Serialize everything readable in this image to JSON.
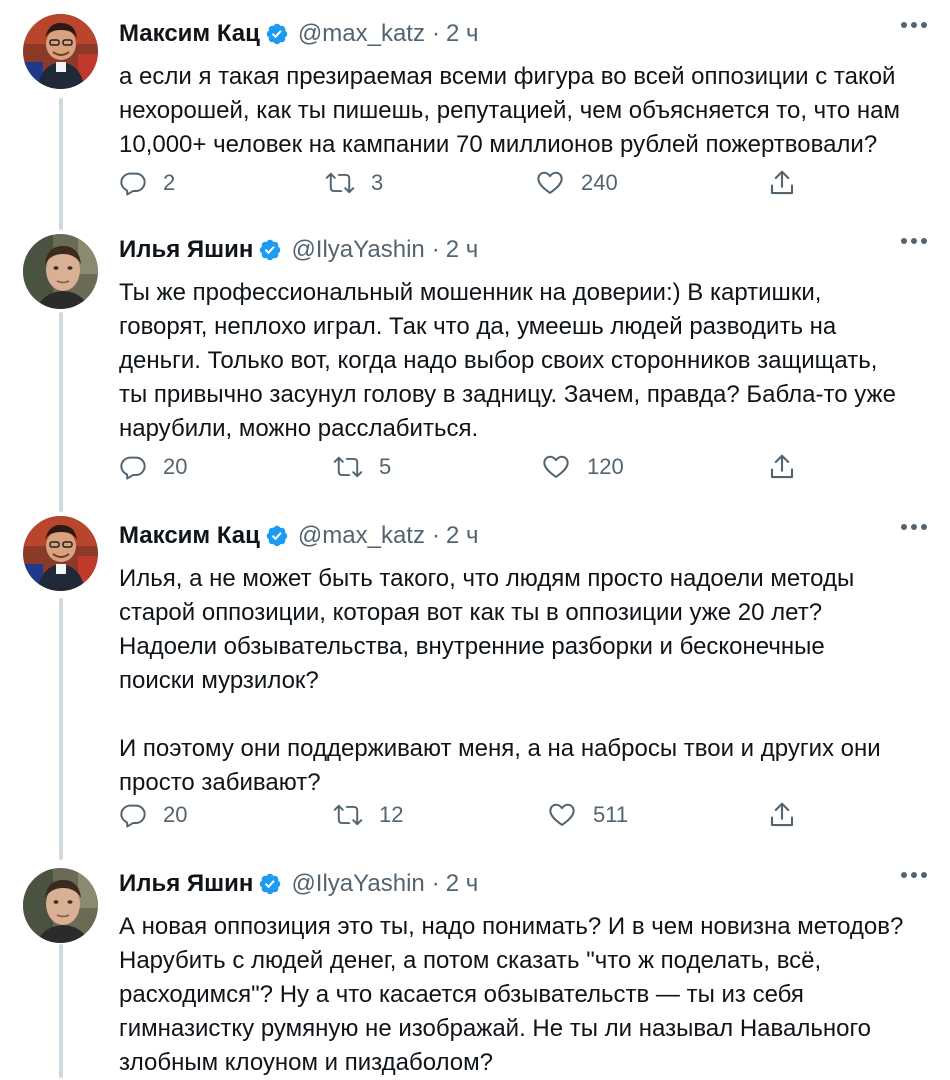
{
  "tweets": [
    {
      "name": "Максим Кац",
      "handle": "@max_katz",
      "dot": "·",
      "time": "2 ч",
      "avatar_icon": "avatar-max-katz",
      "lines": [
        "а если я такая презираемая всеми фигура во всей оппозиции с такой",
        "нехорошей, как ты пишешь, репутацией, чем объясняется то, что нам",
        "10,000+ человек на кампании 70 миллионов рублей пожертвовали?"
      ],
      "replies": "2",
      "retweets": "3",
      "likes": "240"
    },
    {
      "name": "Илья Яшин",
      "handle": "@IlyaYashin",
      "dot": "·",
      "time": "2 ч",
      "avatar_icon": "avatar-ilya-yashin",
      "lines": [
        "Ты же профессиональный мошенник на доверии:) В картишки,",
        "говорят, неплохо играл. Так что да, умеешь людей разводить на",
        "деньги. Только вот, когда надо выбор своих сторонников защищать,",
        "ты привычно засунул голову в задницу. Зачем, правда? Бабла-то уже",
        "нарубили, можно расслабиться."
      ],
      "replies": "20",
      "retweets": "5",
      "likes": "120"
    },
    {
      "name": "Максим Кац",
      "handle": "@max_katz",
      "dot": "·",
      "time": "2 ч",
      "avatar_icon": "avatar-max-katz",
      "lines": [
        "Илья, а не может быть такого, что людям просто надоели методы",
        "старой оппозиции, которая вот как ты в оппозиции уже 20 лет?",
        "Надоели обзывательства, внутренние разборки и бесконечные",
        "поиски мурзилок?"
      ],
      "lines2": [
        "И поэтому они поддерживают меня, а на набросы твои и других они",
        "просто забивают?"
      ],
      "replies": "20",
      "retweets": "12",
      "likes": "511"
    },
    {
      "name": "Илья Яшин",
      "handle": "@IlyaYashin",
      "dot": "·",
      "time": "2 ч",
      "avatar_icon": "avatar-ilya-yashin",
      "lines": [
        "А новая оппозиция это ты, надо понимать? И в чем новизна методов?",
        "Нарубить с людей денег, а потом сказать \"что ж поделать, всё,",
        "расходимся\"? Ну а что касается обзывательств — ты из себя",
        "гимназистку румяную не изображай. Не ты ли называл Навального",
        "злобным клоуном и пиздаболом?"
      ]
    }
  ],
  "colors": {
    "text": "#0f1419",
    "secondary": "#536471",
    "verified": "#1d9bf0",
    "thread_line": "#cfd9de"
  }
}
